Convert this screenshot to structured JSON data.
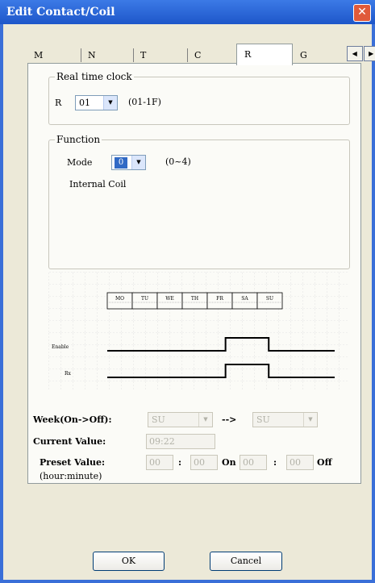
{
  "window": {
    "title": "Edit Contact/Coil",
    "close_glyph": "✕"
  },
  "tabs": [
    {
      "label": "M"
    },
    {
      "label": "N"
    },
    {
      "label": "T"
    },
    {
      "label": "C"
    },
    {
      "label": "R",
      "active": true
    },
    {
      "label": "G"
    }
  ],
  "tab_scroll": {
    "left": "◀",
    "right": "▶"
  },
  "rtc": {
    "legend": "Real time clock",
    "r_label": "R",
    "r_value": "01",
    "r_range": "(01-1F)"
  },
  "function": {
    "legend": "Function",
    "mode_label": "Mode",
    "mode_value": "0",
    "mode_range": "(0~4)",
    "description": "Internal Coil"
  },
  "diagram": {
    "days": [
      "MO",
      "TU",
      "WE",
      "TH",
      "FR",
      "SA",
      "SU"
    ],
    "enable_label": "Enable",
    "rx_label": "Rx",
    "pulse_start_fraction": 0.52,
    "pulse_end_fraction": 0.71
  },
  "settings": {
    "week_label": "Week(On->Off):",
    "week_from": "SU",
    "arrow": "-->",
    "week_to": "SU",
    "current_label": "Current Value:",
    "current_value": "09:22",
    "preset_label": "Preset Value:",
    "on_hour": "00",
    "colon1": ":",
    "on_minute": "00",
    "on_label": "On",
    "off_hour": "00",
    "colon2": ":",
    "off_minute": "00",
    "off_label": "Off",
    "unit_hint": "(hour:minute)"
  },
  "buttons": {
    "ok": "OK",
    "cancel": "Cancel"
  },
  "colors": {
    "titlebar": "#1d56c9",
    "selection": "#316ac5",
    "close": "#e05a3a",
    "dialog": "#ece9d8"
  }
}
